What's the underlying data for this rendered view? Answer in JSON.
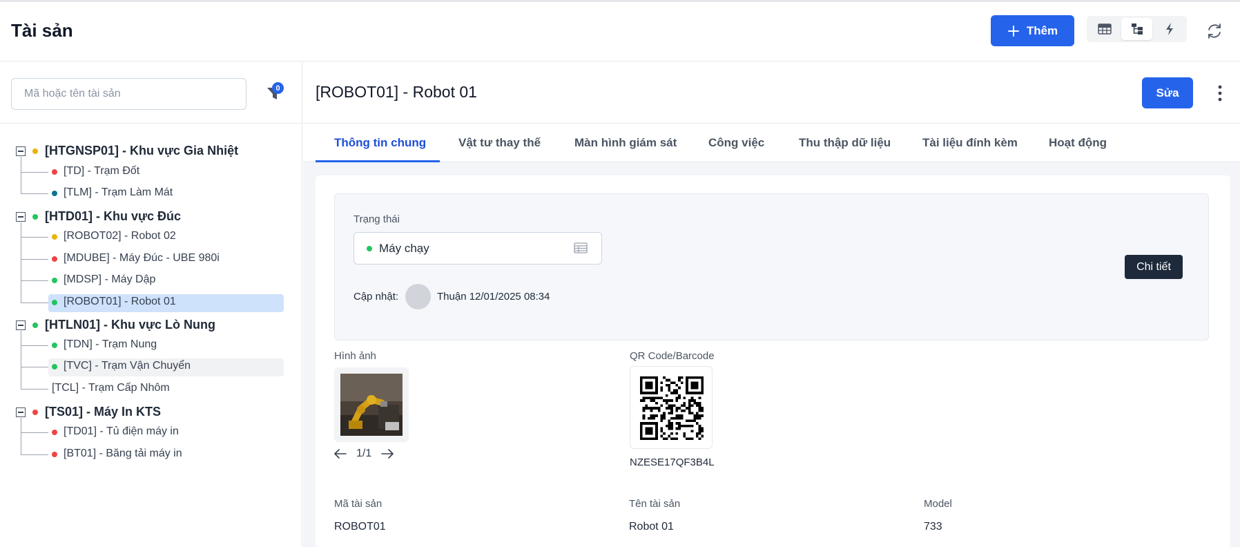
{
  "header": {
    "title": "Tài sản",
    "add_label": "Thêm",
    "colors": {
      "primary": "#2563eb"
    }
  },
  "sidebar": {
    "search_placeholder": "Mã hoặc tên tài sản",
    "filter_count": "0",
    "tree": [
      {
        "label": "[HTGNSP01] - Khu vực Gia Nhiệt",
        "status": "#eab308",
        "children": [
          {
            "label": "[TD] - Trạm Đốt",
            "status": "#ef4444"
          },
          {
            "label": "[TLM] - Trạm Làm Mát",
            "status": "#0e7490"
          }
        ]
      },
      {
        "label": "[HTD01] - Khu vực Đúc",
        "status": "#22c55e",
        "children": [
          {
            "label": "[ROBOT02] - Robot 02",
            "status": "#eab308"
          },
          {
            "label": "[MDUBE] - Máy Đúc - UBE 980i",
            "status": "#ef4444"
          },
          {
            "label": "[MDSP] - Máy Dập",
            "status": "#22c55e"
          },
          {
            "label": "[ROBOT01] - Robot 01",
            "status": "#22c55e",
            "selected": true
          }
        ]
      },
      {
        "label": "[HTLN01] - Khu vực Lò Nung",
        "status": "#22c55e",
        "children": [
          {
            "label": "[TDN] - Trạm Nung",
            "status": "#22c55e"
          },
          {
            "label": "[TVC] - Trạm Vận Chuyển",
            "status": "#22c55e",
            "hover": true
          },
          {
            "label": "[TCL] - Trạm Cấp Nhôm",
            "status": ""
          }
        ]
      },
      {
        "label": "[TS01] - Máy In KTS",
        "status": "#ef4444",
        "children": [
          {
            "label": "[TD01] - Tủ điện máy in",
            "status": "#ef4444"
          },
          {
            "label": "[BT01] - Băng tải máy in",
            "status": "#ef4444"
          }
        ]
      }
    ]
  },
  "main": {
    "title": "[ROBOT01] - Robot 01",
    "edit_label": "Sửa",
    "tabs": [
      {
        "label": "Thông tin chung",
        "active": true
      },
      {
        "label": "Vật tư thay thế"
      },
      {
        "label": "Màn hình giám sát"
      },
      {
        "label": "Công việc"
      },
      {
        "label": "Thu thập dữ liệu"
      },
      {
        "label": "Tài liệu đính kèm"
      },
      {
        "label": "Hoạt động"
      }
    ],
    "status": {
      "label": "Trạng thái",
      "value": "Máy chạy",
      "value_color": "#22c55e",
      "detail_label": "Chi tiết",
      "updated_label": "Cập nhật:",
      "updated_value": "Thuận 12/01/2025 08:34"
    },
    "image": {
      "label": "Hình ảnh",
      "pager": "1/1"
    },
    "qr": {
      "label": "QR Code/Barcode",
      "code": "NZESE17QF3B4L"
    },
    "fields": {
      "asset_code_label": "Mã tài sản",
      "asset_code": "ROBOT01",
      "asset_name_label": "Tên tài sản",
      "asset_name": "Robot 01",
      "model_label": "Model",
      "model": "733"
    }
  }
}
